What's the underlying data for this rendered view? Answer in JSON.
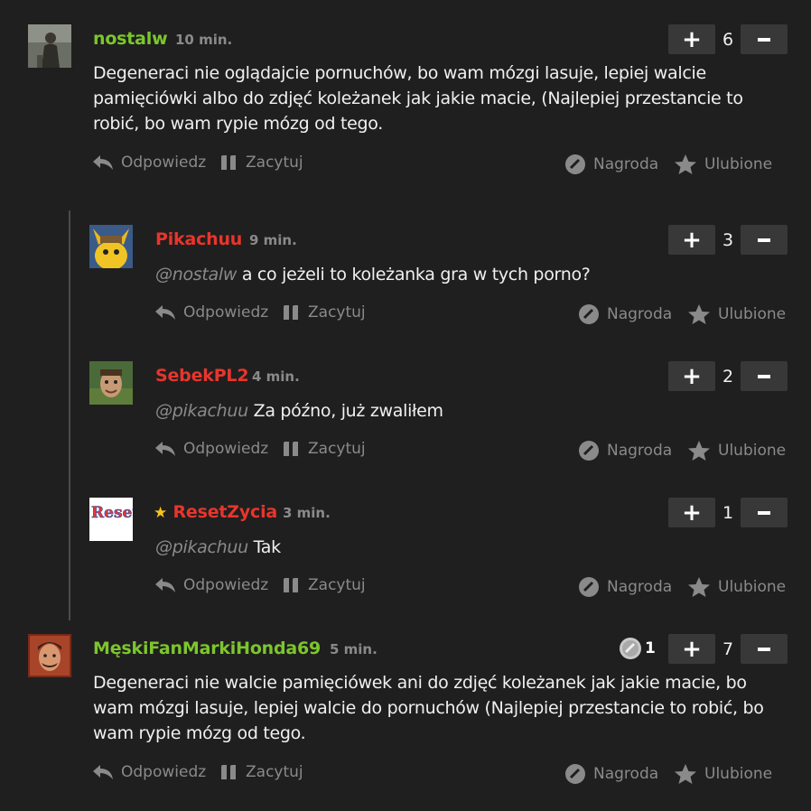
{
  "comments": [
    {
      "username": "nostalw",
      "time": "10 min.",
      "mention": "",
      "text": "Degeneraci nie oglądajcie pornuchów, bo wam mózgi lasuje, lepiej walcie pamięciówki albo do zdjęć koleżanek jak jakie macie, (Najlepiej przestancie to robić, bo wam rypie mózg od tego.",
      "votes": "6"
    },
    {
      "username": "Pikachuu",
      "time": "9 min.",
      "mention": "@nostalw",
      "text": " a co jeżeli to koleżanka gra w tych porno?",
      "votes": "3"
    },
    {
      "username": "SebekPL2",
      "time": "4 min.",
      "mention": "@pikachuu",
      "text": " Za późno, już zwaliłem",
      "votes": "2"
    },
    {
      "username": "ResetZycia",
      "star": "★",
      "time": "3 min.",
      "mention": "@pikachuu",
      "text": " Tak",
      "votes": "1",
      "avatar_text": "Reset"
    },
    {
      "username": "MęskiFanMarkiHonda69",
      "time": "5 min.",
      "mention": "",
      "text": "Degeneraci nie walcie pamięciówek ani do zdjęć koleżanek jak jakie macie, bo wam mózgi lasuje, lepiej walcie do pornuchów (Najlepiej przestancie to robić, bo wam rypie mózg od tego.",
      "votes": "7",
      "award_count": "1"
    }
  ],
  "actions": {
    "reply": "Odpowiedz",
    "quote": "Zacytuj",
    "award": "Nagroda",
    "favorite": "Ulubione"
  },
  "colors": {
    "background": "#1f1f1f",
    "username_green": "#7cc62d",
    "username_red": "#e8352c",
    "muted": "#8a8a8a",
    "vote_button": "#383838",
    "star": "#f5c518"
  }
}
